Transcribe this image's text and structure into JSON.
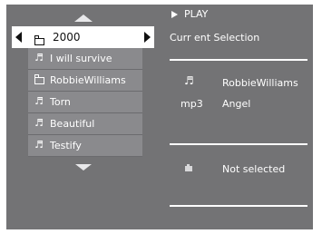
{
  "browser": {
    "selected_folder": "2000",
    "items": [
      {
        "icon": "music-note-icon",
        "label": "I will survive"
      },
      {
        "icon": "folder-icon",
        "label": "RobbieWilliams"
      },
      {
        "icon": "music-note-icon",
        "label": "Torn"
      },
      {
        "icon": "music-note-icon",
        "label": "Beautiful"
      },
      {
        "icon": "music-note-icon",
        "label": "Testify"
      }
    ]
  },
  "playback": {
    "play_label": "PLAY",
    "current_selection_label": "Curr ent Selection",
    "artist": "RobbieWilliams",
    "format": "mp3",
    "track": "Angel",
    "image_status": "Not selected"
  }
}
